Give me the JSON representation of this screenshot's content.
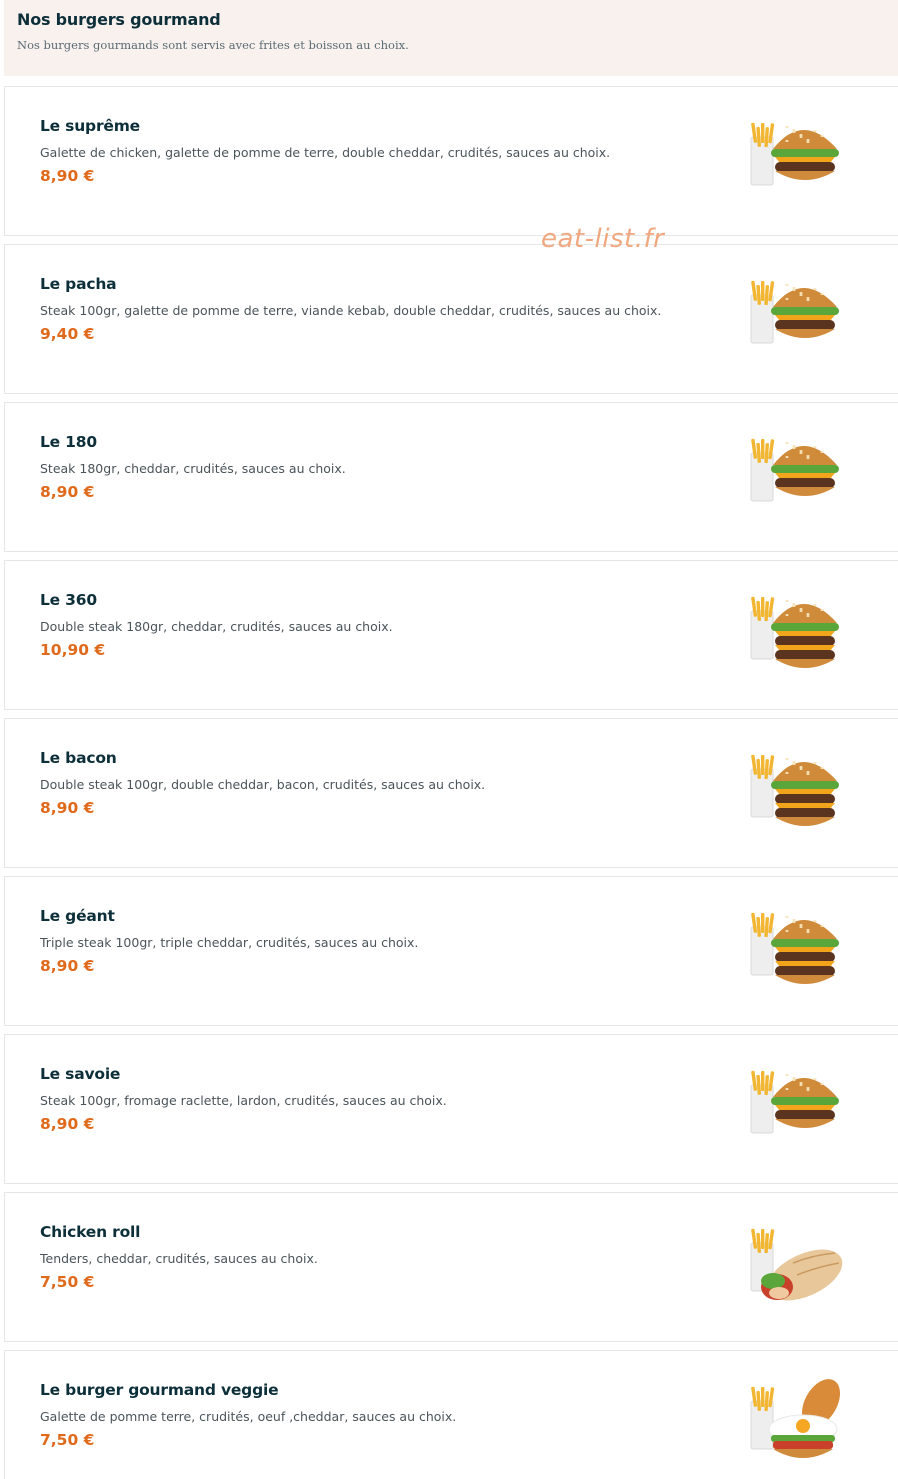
{
  "section": {
    "title": "Nos burgers gourmand",
    "subtitle": "Nos burgers gourmands sont servis avec frites et boisson au choix."
  },
  "watermark": "eat-list.fr",
  "accent_color": "#e06a1c",
  "items": [
    {
      "name": "Le suprême",
      "description": "Galette de chicken, galette de pomme de terre, double cheddar, crudités, sauces au choix.",
      "price": "8,90 €",
      "image": "burger-fries-icon"
    },
    {
      "name": "Le pacha",
      "description": "Steak 100gr, galette de pomme de terre, viande kebab, double cheddar, crudités, sauces au choix.",
      "price": "9,40 €",
      "image": "burger-fries-icon"
    },
    {
      "name": "Le 180",
      "description": "Steak 180gr, cheddar, crudités, sauces au choix.",
      "price": "8,90 €",
      "image": "burger-fries-icon"
    },
    {
      "name": "Le 360",
      "description": "Double steak 180gr, cheddar, crudités, sauces au choix.",
      "price": "10,90 €",
      "image": "double-burger-fries-icon"
    },
    {
      "name": "Le bacon",
      "description": "Double steak 100gr, double cheddar, bacon, crudités, sauces au choix.",
      "price": "8,90 €",
      "image": "double-burger-fries-icon"
    },
    {
      "name": "Le géant",
      "description": "Triple steak 100gr, triple cheddar, crudités, sauces au choix.",
      "price": "8,90 €",
      "image": "double-burger-fries-icon"
    },
    {
      "name": "Le savoie",
      "description": "Steak 100gr, fromage raclette, lardon, crudités, sauces au choix.",
      "price": "8,90 €",
      "image": "burger-fries-icon"
    },
    {
      "name": "Chicken roll",
      "description": "Tenders, cheddar, crudités, sauces au choix.",
      "price": "7,50 €",
      "image": "wrap-fries-icon"
    },
    {
      "name": "Le burger gourmand veggie",
      "description": "Galette de pomme terre, crudités, oeuf ,cheddar, sauces au choix.",
      "price": "7,50 €",
      "image": "veggie-burger-fries-icon"
    }
  ]
}
